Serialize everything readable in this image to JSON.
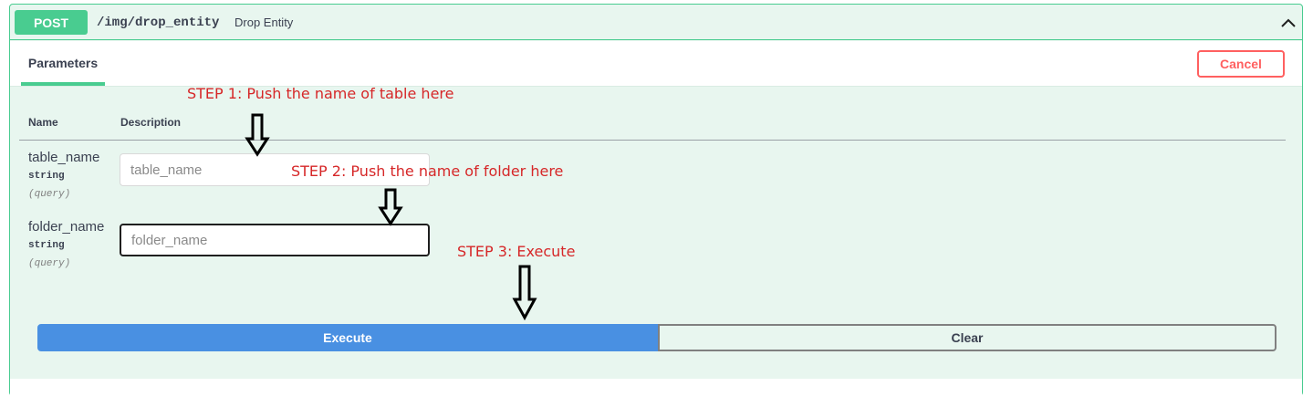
{
  "operation": {
    "method": "POST",
    "path": "/img/drop_entity",
    "summary": "Drop Entity",
    "collapse_icon": "chevron-up-icon",
    "method_color": "#49cc90"
  },
  "tabs": {
    "parameters_label": "Parameters",
    "cancel_label": "Cancel"
  },
  "table": {
    "col_name": "Name",
    "col_description": "Description"
  },
  "params": [
    {
      "name": "table_name",
      "type": "string",
      "in": "(query)",
      "placeholder": "table_name",
      "value": ""
    },
    {
      "name": "folder_name",
      "type": "string",
      "in": "(query)",
      "placeholder": "folder_name",
      "value": ""
    }
  ],
  "actions": {
    "execute_label": "Execute",
    "clear_label": "Clear",
    "execute_color": "#4990e2"
  },
  "annotations": {
    "step1": "STEP 1: Push the name of table here",
    "step2": "STEP 2: Push the name of folder here",
    "step3": "STEP 3: Execute",
    "color": "#d62728",
    "arrow_icon": "arrow-down-icon"
  }
}
